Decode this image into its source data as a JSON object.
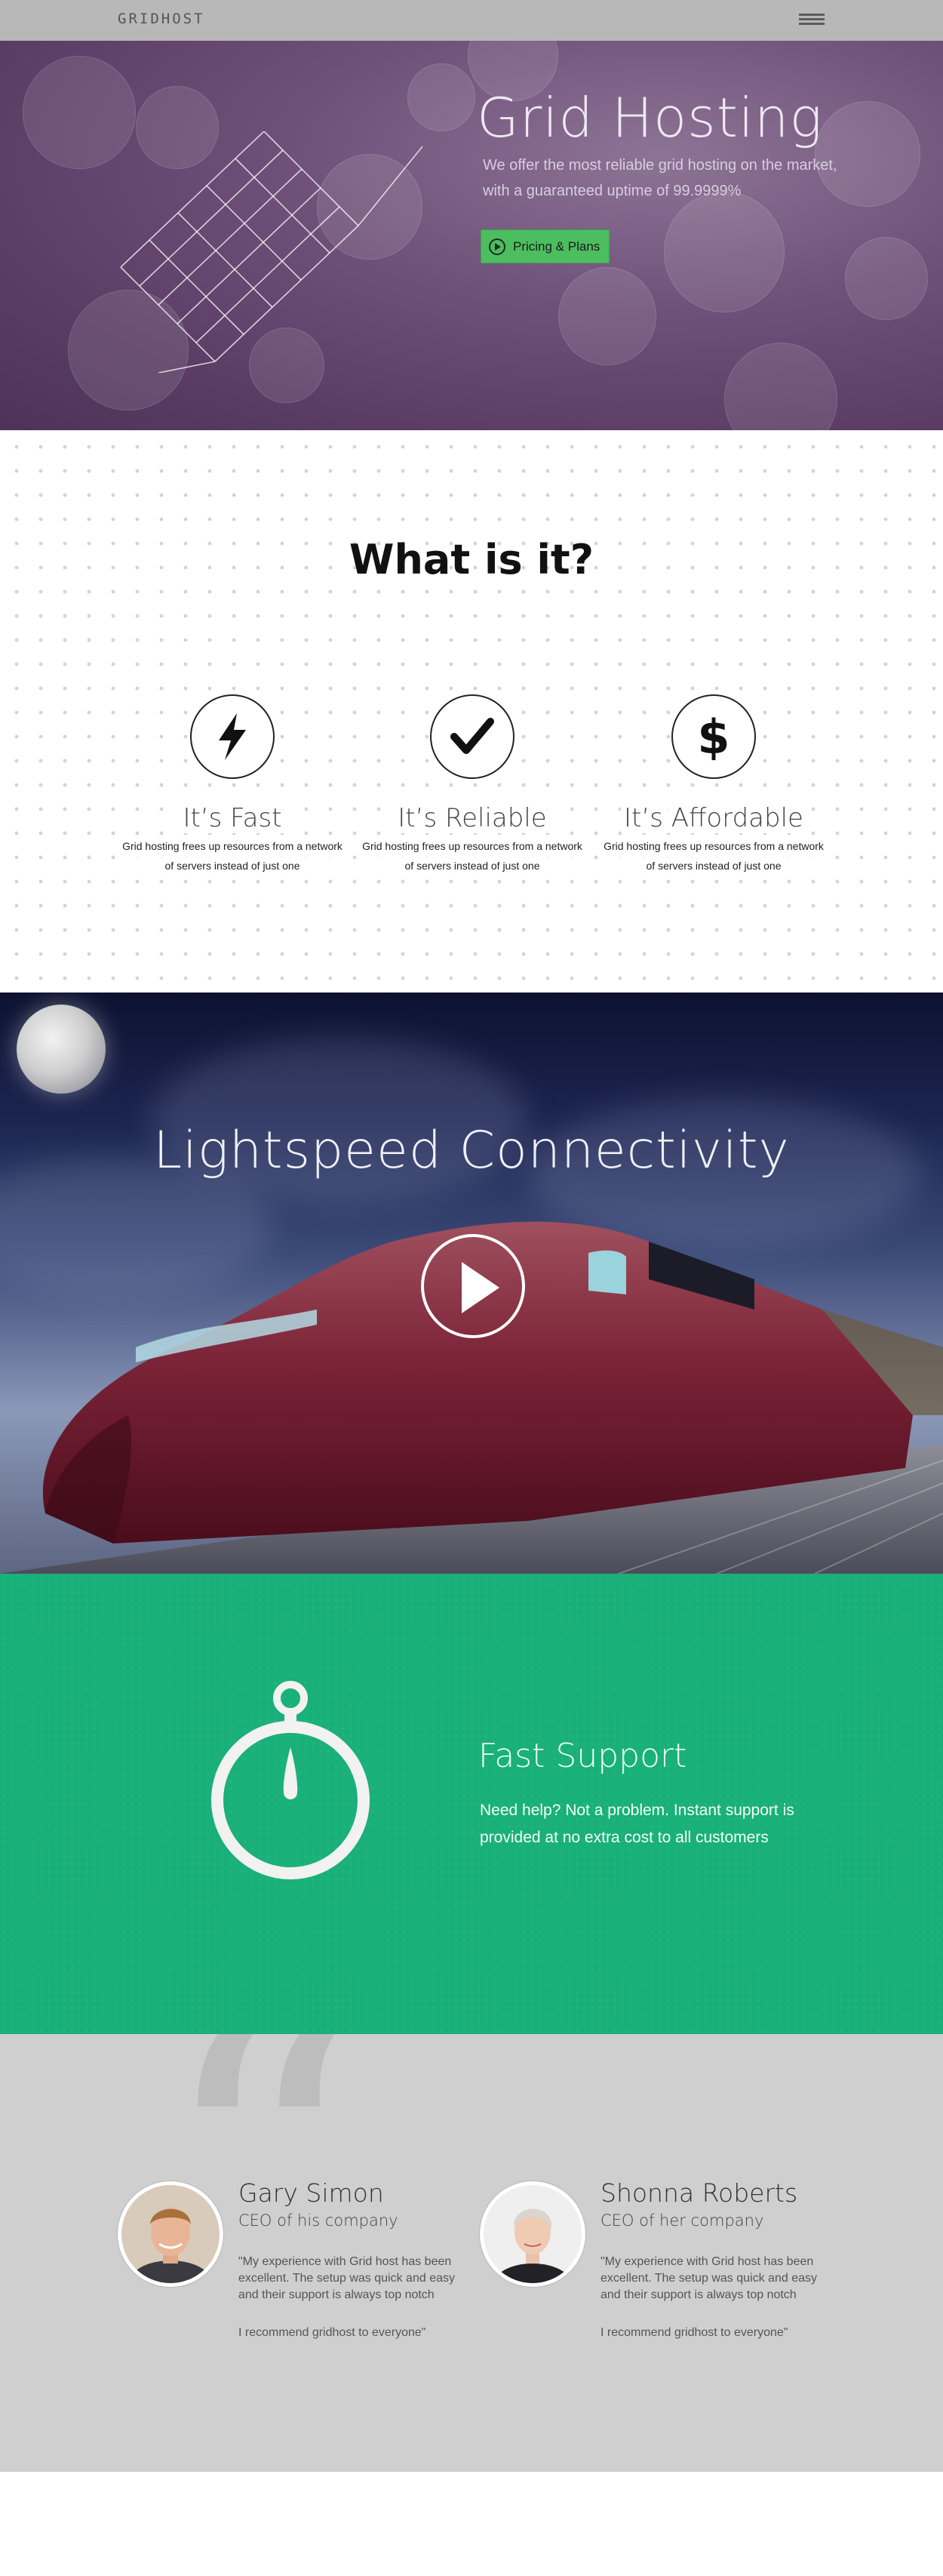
{
  "nav": {
    "logo": "GRIDHOST",
    "menu_icon": "hamburger-menu-icon"
  },
  "hero": {
    "title": "Grid Hosting",
    "subtitle": "We offer the most reliable grid hosting on the market, with a guaranteed uptime of 99.9999%",
    "cta_label": "Pricing & Plans",
    "cta_icon": "play-circle-icon",
    "accent_color": "#4cbe5f"
  },
  "whatis": {
    "title": "What is it?",
    "features": [
      {
        "icon": "lightning-bolt-icon",
        "glyph": "⚡",
        "title": "It’s Fast",
        "desc_line1": "Grid hosting frees up resources from a network",
        "desc_line2": "of servers instead of just one"
      },
      {
        "icon": "checkmark-icon",
        "glyph": "✔",
        "title": "It’s Reliable",
        "desc_line1": "Grid hosting frees up resources from a network",
        "desc_line2": "of servers instead of just one"
      },
      {
        "icon": "dollar-icon",
        "glyph": "$",
        "title": "It’s Affordable",
        "desc_line1": "Grid hosting frees up resources from a network",
        "desc_line2": "of servers instead of just one"
      }
    ]
  },
  "lightspeed": {
    "title": "Lightspeed Connectivity",
    "play_icon": "video-play-icon"
  },
  "support": {
    "title": "Fast Support",
    "description": "Need help? Not a problem. Instant support is provided at no extra cost to all customers",
    "icon": "stopwatch-icon",
    "background_color": "#19b07a"
  },
  "testimonials": {
    "items": [
      {
        "name": "Gary Simon",
        "role": "CEO of his company",
        "quote": "\"My experience with Grid host has been excellent. The setup was quick and easy and their support is always top notch",
        "recommend": "I recommend gridhost to everyone\""
      },
      {
        "name": "Shonna Roberts",
        "role": "CEO of her company",
        "quote": "\"My experience with Grid host has been excellent. The setup was quick and easy and their support is always top notch",
        "recommend": "I recommend gridhost to everyone\""
      }
    ]
  }
}
